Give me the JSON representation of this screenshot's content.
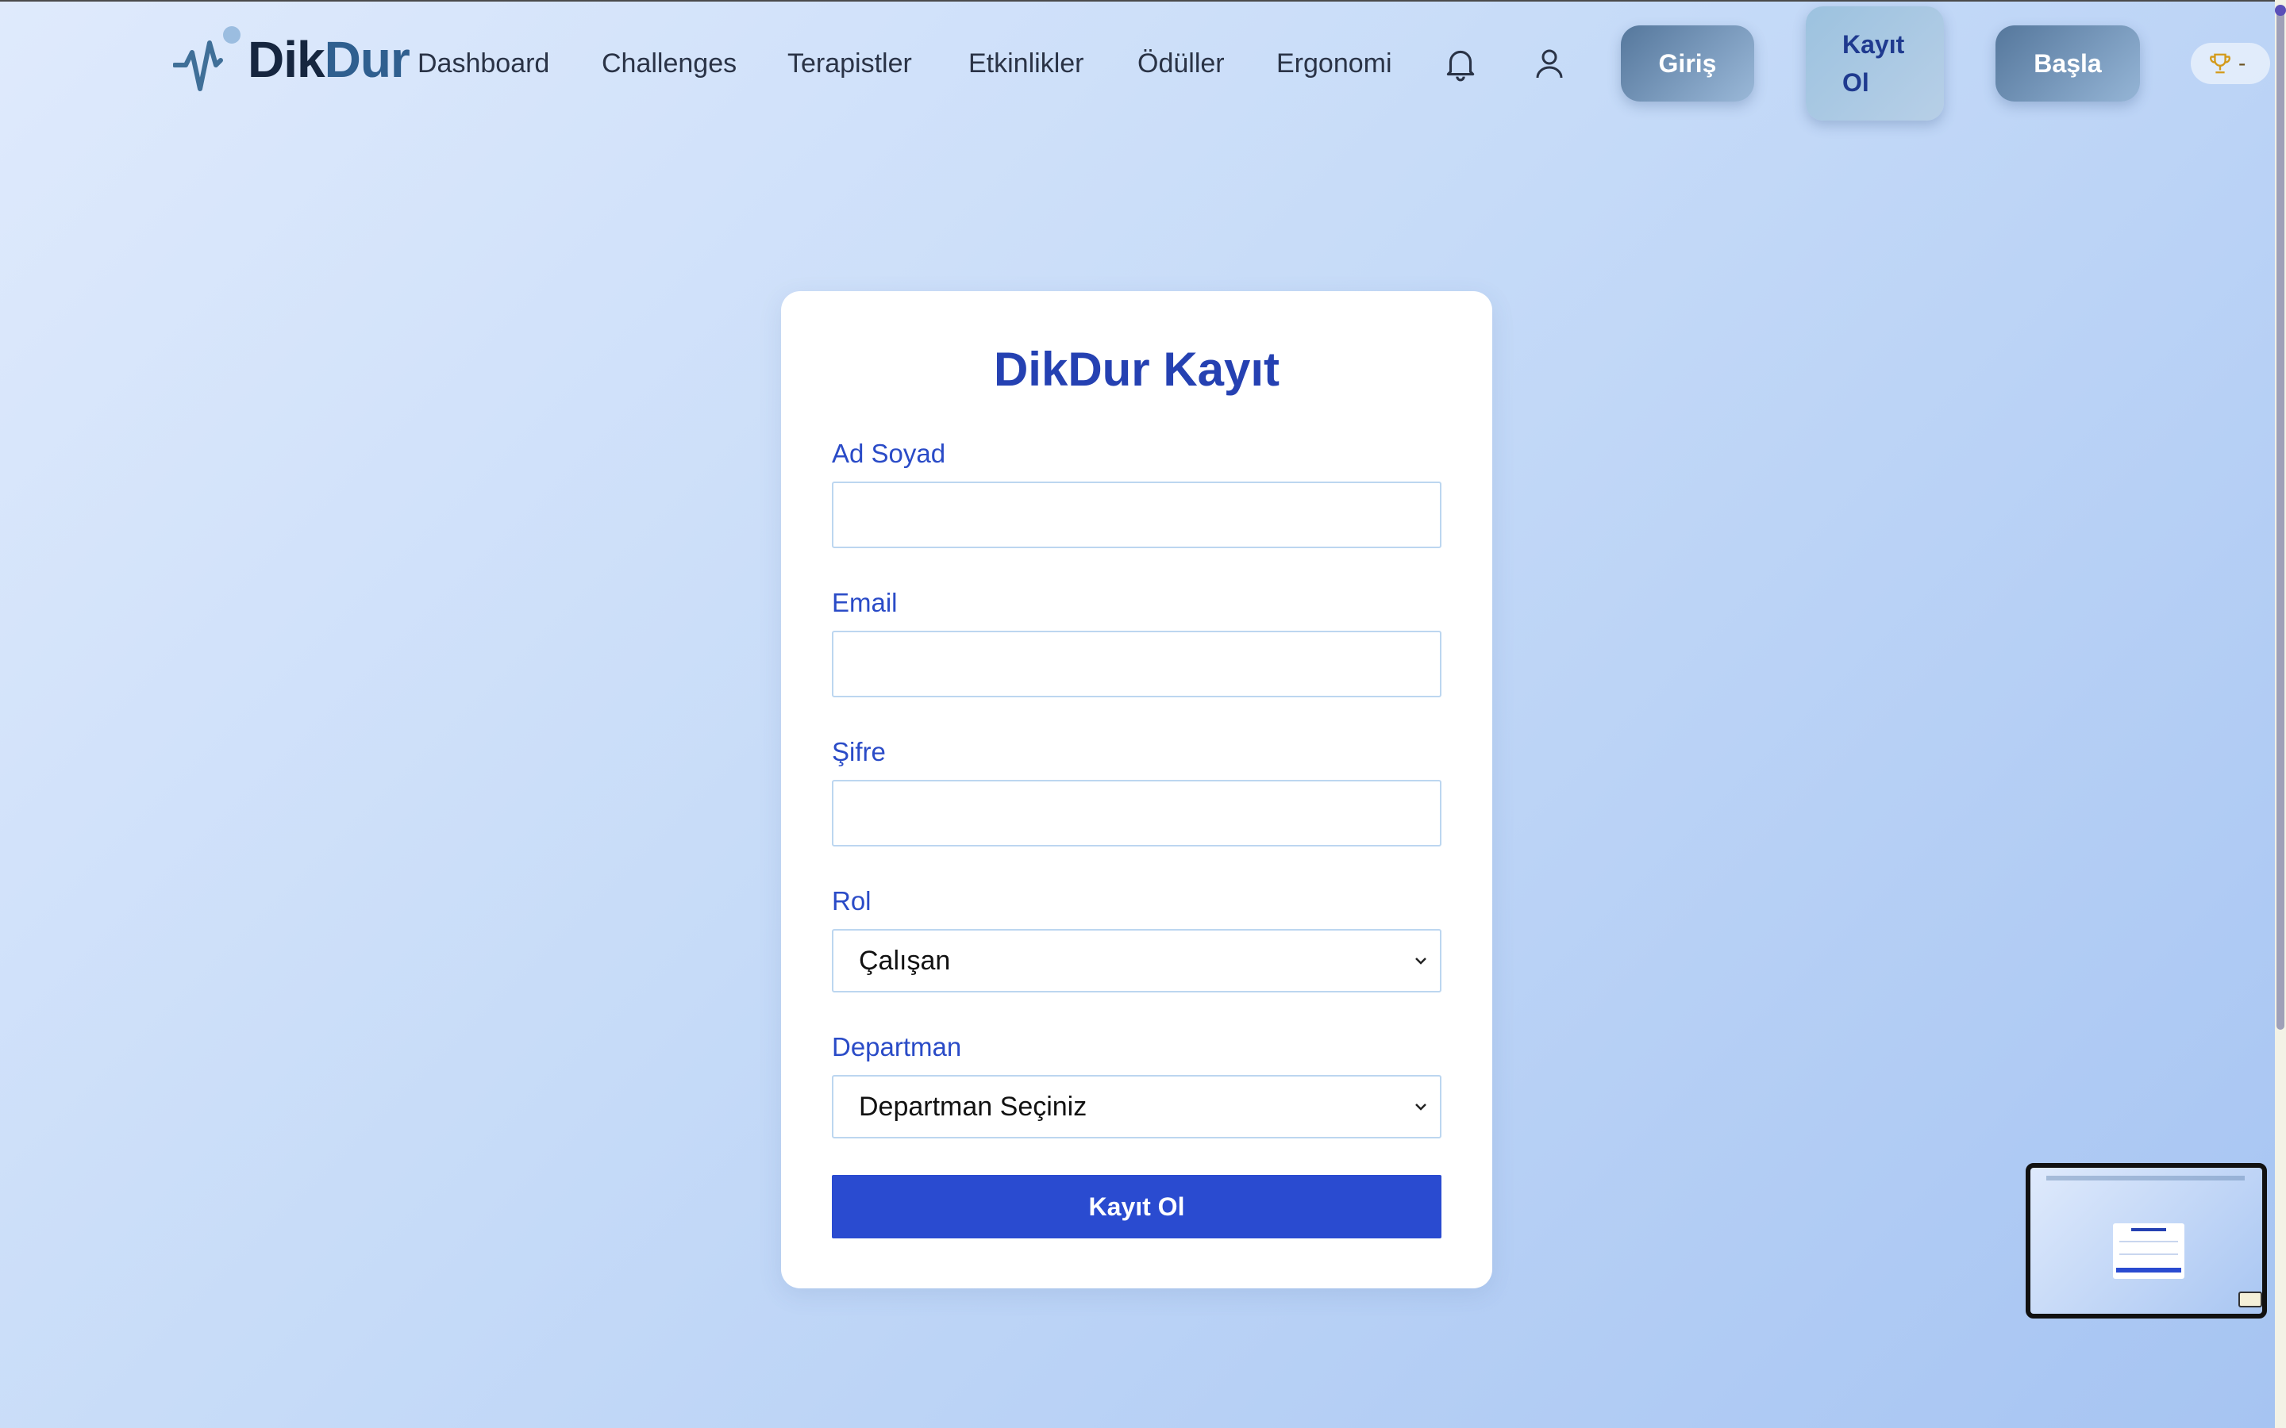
{
  "brand": {
    "dik": "DikDur",
    "dur": ""
  },
  "nav": [
    {
      "label": "Dashboard"
    },
    {
      "label": "Challenges"
    },
    {
      "label": "Terapistler"
    },
    {
      "label": "Etkinlikler"
    },
    {
      "label": "Ödüller"
    },
    {
      "label": "Ergonomi"
    }
  ],
  "header": {
    "login": "Giriş",
    "register_line1": "Kayıt",
    "register_line2": "Ol",
    "start": "Başla",
    "score": "-"
  },
  "form": {
    "title": "DikDur Kayıt",
    "name_label": "Ad Soyad",
    "name_value": "",
    "email_label": "Email",
    "email_value": "",
    "password_label": "Şifre",
    "password_value": "",
    "role_label": "Rol",
    "role_value": "Çalışan",
    "department_label": "Departman",
    "department_value": "Departman Seçiniz",
    "submit": "Kayıt Ol"
  },
  "colors": {
    "accent": "#2a4bd0",
    "title": "#2541b2",
    "label": "#2a4bc7",
    "logo_dark": "#16263f",
    "logo_blue": "#2f5f8f"
  },
  "icons": [
    "pulse-logo-icon",
    "bell-icon",
    "user-icon",
    "trophy-icon",
    "chevron-down-icon"
  ]
}
